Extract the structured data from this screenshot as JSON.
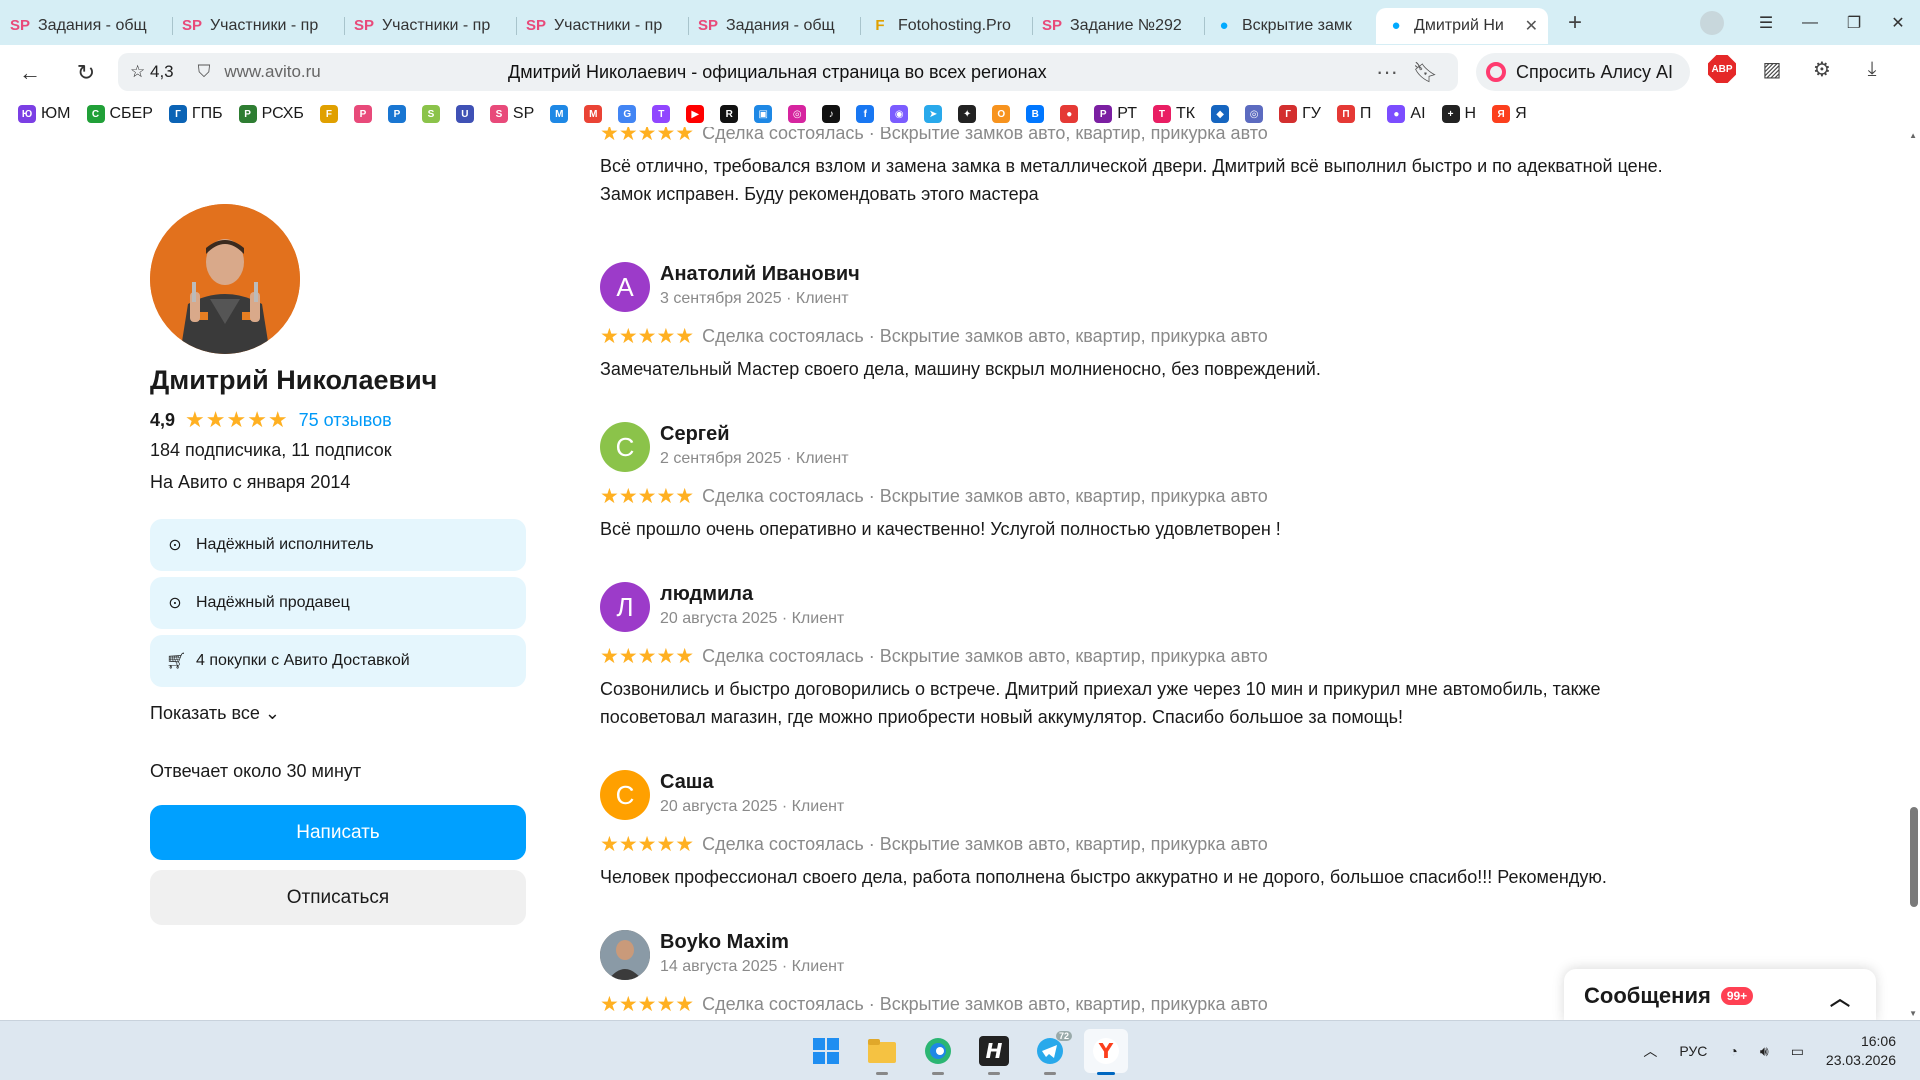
{
  "browser": {
    "tabs": [
      {
        "icon": "SP",
        "title": "Задания - общ",
        "color": "#e84a7a"
      },
      {
        "icon": "SP",
        "title": "Участники - пр",
        "color": "#e84a7a"
      },
      {
        "icon": "SP",
        "title": "Участники - пр",
        "color": "#e84a7a"
      },
      {
        "icon": "SP",
        "title": "Участники - пр",
        "color": "#e84a7a"
      },
      {
        "icon": "SP",
        "title": "Задания - общ",
        "color": "#e84a7a"
      },
      {
        "icon": "F",
        "title": "Fotohosting.Pro",
        "color": "#e0a000"
      },
      {
        "icon": "SP",
        "title": "Задание №292",
        "color": "#e84a7a"
      },
      {
        "icon": "●",
        "title": "Вскрытие замк",
        "color": "#00aaff"
      },
      {
        "icon": "●",
        "title": "Дмитрий Ни",
        "color": "#00aaff",
        "active": true
      }
    ],
    "close_glyph": "✕",
    "address": {
      "rating": "4,3",
      "host": "www.avito.ru",
      "page_title": "Дмитрий Николаевич - официальная страница во всех регионах"
    },
    "alice_label": "Спросить Алису AI",
    "abp_label": "ABP",
    "bookmarks": [
      {
        "label": "ЮМ",
        "color": "#7b3fe4",
        "glyph": "Ю"
      },
      {
        "label": "СБЕР",
        "color": "#21a038",
        "glyph": "С"
      },
      {
        "label": "ГПБ",
        "color": "#0b63b5",
        "glyph": "Г"
      },
      {
        "label": "РСХБ",
        "color": "#2e7d32",
        "glyph": "Р"
      },
      {
        "label": "",
        "color": "#e0a000",
        "glyph": "F"
      },
      {
        "label": "",
        "color": "#e84a7a",
        "glyph": "P"
      },
      {
        "label": "",
        "color": "#1976d2",
        "glyph": "P"
      },
      {
        "label": "",
        "color": "#8bc34a",
        "glyph": "S"
      },
      {
        "label": "",
        "color": "#3f51b5",
        "glyph": "U"
      },
      {
        "label": "SP",
        "color": "#e84a7a",
        "glyph": "S"
      },
      {
        "label": "",
        "color": "#1e88e5",
        "glyph": "M"
      },
      {
        "label": "",
        "color": "#ea4335",
        "glyph": "M"
      },
      {
        "label": "",
        "color": "#4285f4",
        "glyph": "G"
      },
      {
        "label": "",
        "color": "#9146ff",
        "glyph": "T"
      },
      {
        "label": "",
        "color": "#ff0000",
        "glyph": "▶"
      },
      {
        "label": "",
        "color": "#111111",
        "glyph": "R"
      },
      {
        "label": "",
        "color": "#1e88e5",
        "glyph": "▣"
      },
      {
        "label": "",
        "color": "#d6249f",
        "glyph": "◎"
      },
      {
        "label": "",
        "color": "#111111",
        "glyph": "♪"
      },
      {
        "label": "",
        "color": "#1877f2",
        "glyph": "f"
      },
      {
        "label": "",
        "color": "#7b5cff",
        "glyph": "◉"
      },
      {
        "label": "",
        "color": "#29a9eb",
        "glyph": "➤"
      },
      {
        "label": "",
        "color": "#222222",
        "glyph": "✦"
      },
      {
        "label": "",
        "color": "#f7931e",
        "glyph": "О"
      },
      {
        "label": "",
        "color": "#0077ff",
        "glyph": "В"
      },
      {
        "label": "",
        "color": "#e53935",
        "glyph": "●"
      },
      {
        "label": "РТ",
        "color": "#7b1fa2",
        "glyph": "Р"
      },
      {
        "label": "ТК",
        "color": "#e91e63",
        "glyph": "Т"
      },
      {
        "label": "",
        "color": "#1565c0",
        "glyph": "◆"
      },
      {
        "label": "",
        "color": "#5c6bc0",
        "glyph": "◎"
      },
      {
        "label": "ГУ",
        "color": "#d32f2f",
        "glyph": "Г"
      },
      {
        "label": "П",
        "color": "#e53935",
        "glyph": "П"
      },
      {
        "label": "AI",
        "color": "#7c4dff",
        "glyph": "●"
      },
      {
        "label": "Н",
        "color": "#222222",
        "glyph": "+"
      },
      {
        "label": "Я",
        "color": "#fc3f1d",
        "glyph": "Я"
      }
    ]
  },
  "profile": {
    "name": "Дмитрий Николаевич",
    "rating": "4,9",
    "stars": "★★★★★",
    "reviews_link": "75 отзывов",
    "subscriptions": "184 подписчика, 11 подписок",
    "since": "На Авито с января 2014",
    "badges": [
      {
        "label": "Надёжный исполнитель",
        "icon": "check-circle-icon"
      },
      {
        "label": "Надёжный продавец",
        "icon": "check-circle-icon"
      },
      {
        "label": "4 покупки с Авито Доставкой",
        "icon": "cart-icon"
      }
    ],
    "show_all": "Показать все",
    "answers": "Отвечает около 30 минут",
    "write_button": "Написать",
    "unsubscribe_button": "Отписаться"
  },
  "reviews": [
    {
      "author": "",
      "meta": "",
      "deal": "Сделка состоялась · Вскрытие замков авто, квартир, прикурка авто",
      "text": "Всё отлично, требовался взлом и замена замка в металлической двери. Дмитрий всё выполнил быстро и по адекватной цене.\nЗамок исправен. Буду рекомендовать этого мастера"
    },
    {
      "author": "Анатолий Иванович",
      "initial": "А",
      "color": "#9c3bc9",
      "meta": "3 сентября 2025 · Клиент",
      "deal": "Сделка состоялась · Вскрытие замков авто, квартир, прикурка авто",
      "text": "Замечательный Мастер своего дела, машину вскрыл молниеносно, без повреждений."
    },
    {
      "author": "Сергей",
      "initial": "С",
      "color": "#8bc34a",
      "meta": "2 сентября 2025 · Клиент",
      "deal": "Сделка состоялась · Вскрытие замков авто, квартир, прикурка авто",
      "text": "Всё прошло очень оперативно и качественно! Услугой полностью удовлетворен !"
    },
    {
      "author": "людмила",
      "initial": "Л",
      "color": "#9c3bc9",
      "meta": "20 августа 2025 · Клиент",
      "deal": "Сделка состоялась · Вскрытие замков авто, квартир, прикурка авто",
      "text": "Созвонились и быстро договорились о встрече. Дмитрий приехал уже через 10 мин и прикурил мне автомобиль, также\nпосоветовал магазин, где можно приобрести новый аккумулятор. Спасибо большое за помощь!"
    },
    {
      "author": "Саша",
      "initial": "С",
      "color": "#ffa000",
      "meta": "20 августа 2025 · Клиент",
      "deal": "Сделка состоялась · Вскрытие замков авто, квартир, прикурка авто",
      "text": "Человек профессионал своего дела, работа пополнена быстро аккуратно и не дорого, большое спасибо!!! Рекомендую."
    },
    {
      "author": "Boyko Maxim",
      "initial": "",
      "color": "#6d5a4a",
      "meta": "14 августа 2025 · Клиент",
      "deal": "Сделка состоялась · Вскрытие замков авто, квартир, прикурка авто",
      "text": ""
    }
  ],
  "review_stars": "★★★★★",
  "messages": {
    "title": "Сообщения",
    "count": "99+"
  },
  "taskbar": {
    "lang": "РУС",
    "time": "16:06",
    "date": "23.03.2026",
    "telegram_badge": "72"
  }
}
